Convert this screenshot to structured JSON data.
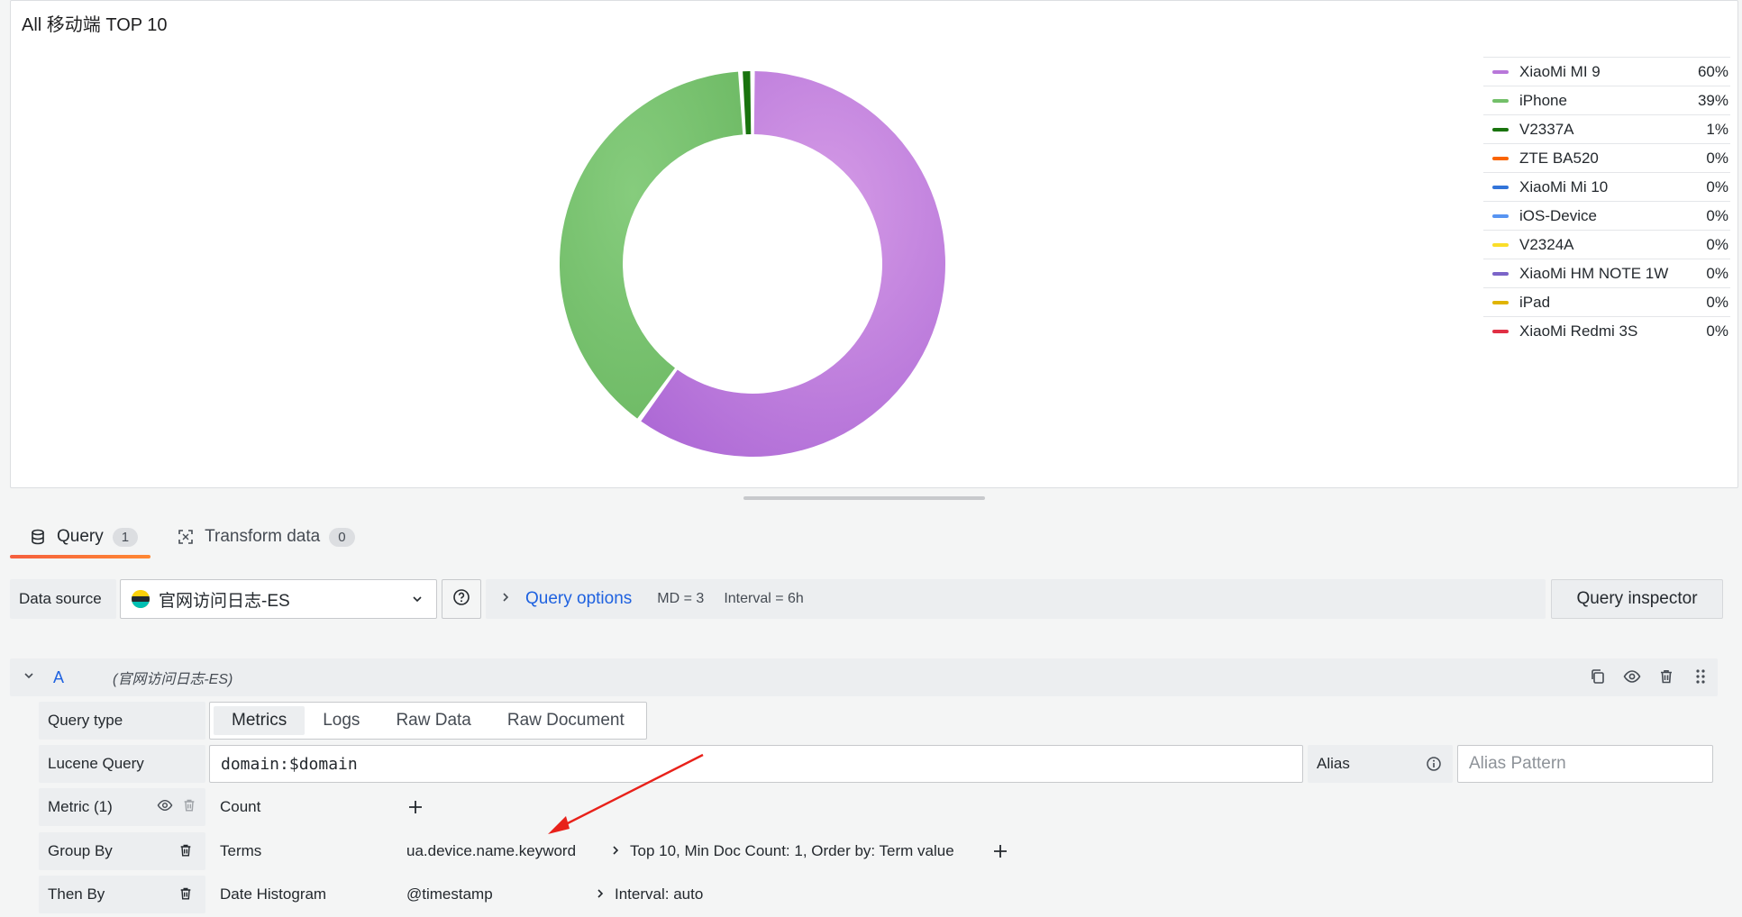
{
  "panel": {
    "title": "All 移动端 TOP 10"
  },
  "chart_data": {
    "type": "pie",
    "categories": [
      "XiaoMi MI 9",
      "iPhone",
      "V2337A",
      "ZTE BA520",
      "XiaoMi Mi 10",
      "iOS-Device",
      "V2324A",
      "XiaoMi HM NOTE 1W",
      "iPad",
      "XiaoMi Redmi 3S"
    ],
    "values": [
      60,
      39,
      1,
      0,
      0,
      0,
      0,
      0,
      0,
      0
    ],
    "value_labels": [
      "60%",
      "39%",
      "1%",
      "0%",
      "0%",
      "0%",
      "0%",
      "0%",
      "0%",
      "0%"
    ],
    "colors": [
      "#b877d9",
      "#73bf69",
      "#19730e",
      "#fa6400",
      "#3274d9",
      "#5794f2",
      "#fade2a",
      "#7b64c8",
      "#e0b400",
      "#e02f44"
    ],
    "donut": true,
    "legend_placement": "right"
  },
  "tabs": [
    {
      "label": "Query",
      "count": "1",
      "icon": "database-icon"
    },
    {
      "label": "Transform data",
      "count": "0",
      "icon": "transform-icon"
    }
  ],
  "toolbar": {
    "datasource_label": "Data source",
    "datasource_value": "官网访问日志-ES",
    "query_options_label": "Query options",
    "md": "MD = 3",
    "interval": "Interval = 6h",
    "inspector_label": "Query inspector"
  },
  "query": {
    "letter": "A",
    "datasource": "(官网访问日志-ES)",
    "query_type_label": "Query type",
    "query_types": [
      "Metrics",
      "Logs",
      "Raw Data",
      "Raw Document"
    ],
    "lucene_label": "Lucene Query",
    "lucene_value": "domain:$domain",
    "alias_label": "Alias",
    "alias_placeholder": "Alias Pattern",
    "metric_label": "Metric (1)",
    "metric_value": "Count",
    "group_by_label": "Group By",
    "group_by_type": "Terms",
    "group_by_field": "ua.device.name.keyword",
    "group_by_options": "Top 10, Min Doc Count: 1, Order by: Term value",
    "then_by_label": "Then By",
    "then_by_type": "Date Histogram",
    "then_by_field": "@timestamp",
    "then_by_options": "Interval: auto"
  }
}
